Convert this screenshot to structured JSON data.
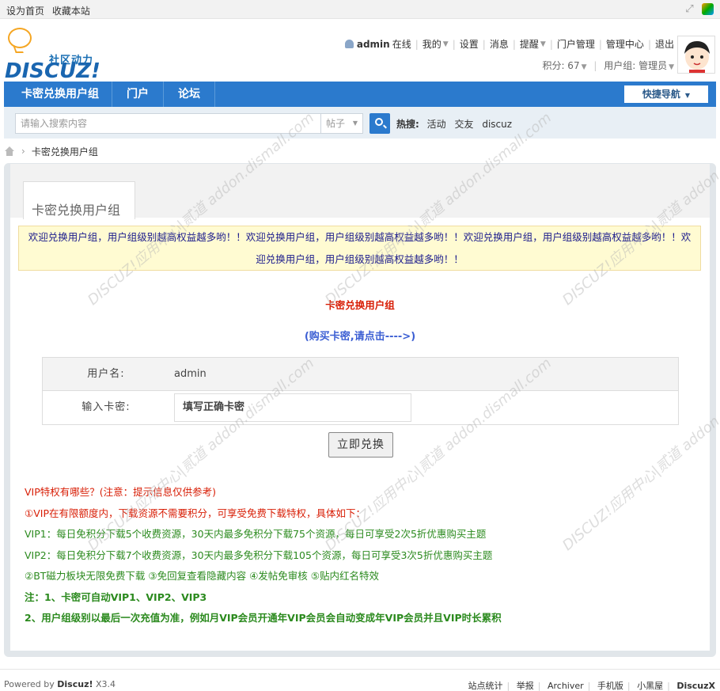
{
  "topbar": {
    "set_home": "设为首页",
    "bookmark": "收藏本站"
  },
  "header": {
    "logo_cn": "社区动力",
    "logo_en": "DISCUZ!",
    "username": "admin",
    "online": "在线",
    "menu": [
      "我的",
      "设置",
      "消息",
      "提醒",
      "门户管理",
      "管理中心",
      "退出"
    ],
    "credits_label": "积分: 67",
    "usergroup_label": "用户组: 管理员"
  },
  "nav": {
    "items": [
      "卡密兑换用户组",
      "门户",
      "论坛"
    ],
    "quick_nav": "快捷导航"
  },
  "search": {
    "placeholder": "请输入搜索内容",
    "type": "帖子",
    "hot_label": "热搜:",
    "hot_items": [
      "活动",
      "交友",
      "discuz"
    ]
  },
  "breadcrumb": {
    "current": "卡密兑换用户组"
  },
  "main": {
    "tab_title": "卡密兑换用户组",
    "notice": "欢迎兑换用户组，用户组级别越高权益越多哟！！欢迎兑换用户组，用户组级别越高权益越多哟！！欢迎兑换用户组，用户组级别越高权益越多哟！！欢迎兑换用户组，用户组级别越高权益越多哟！！",
    "heading": "卡密兑换用户组",
    "buy_link": "(购买卡密,请点击---->)",
    "form": {
      "username_label": "用户名:",
      "username_value": "admin",
      "card_label": "输入卡密:",
      "card_placeholder": "填写正确卡密"
    },
    "submit": "立即兑换",
    "info": [
      "VIP特权有哪些？(注意：提示信息仅供参考)",
      "①VIP在有限额度内，下载资源不需要积分，可享受免费下载特权，具体如下：",
      "VIP1：每日免积分下载5个收费资源，30天内最多免积分下载75个资源，每日可享受2次5折优惠购买主题",
      "VIP2：每日免积分下载7个收费资源，30天内最多免积分下载105个资源，每日可享受3次5折优惠购买主题",
      "②BT磁力板块无限免费下载 ③免回复查看隐藏内容 ④发帖免审核 ⑤贴内红名特效",
      "注：1、卡密可自动VIP1、VIP2、VIP3",
      "2、用户组级别以最后一次充值为准，例如月VIP会员开通年VIP会员会自动变成年VIP会员并且VIP时长累积"
    ]
  },
  "watermark": "DISCUZ!应用中心|贰道 addon.dismall.com",
  "footer": {
    "powered": "Powered by",
    "product": "Discuz!",
    "version": "X3.4",
    "links": [
      "站点统计",
      "举报",
      "Archiver",
      "手机版",
      "小黑屋"
    ],
    "brand": "DiscuzX"
  }
}
